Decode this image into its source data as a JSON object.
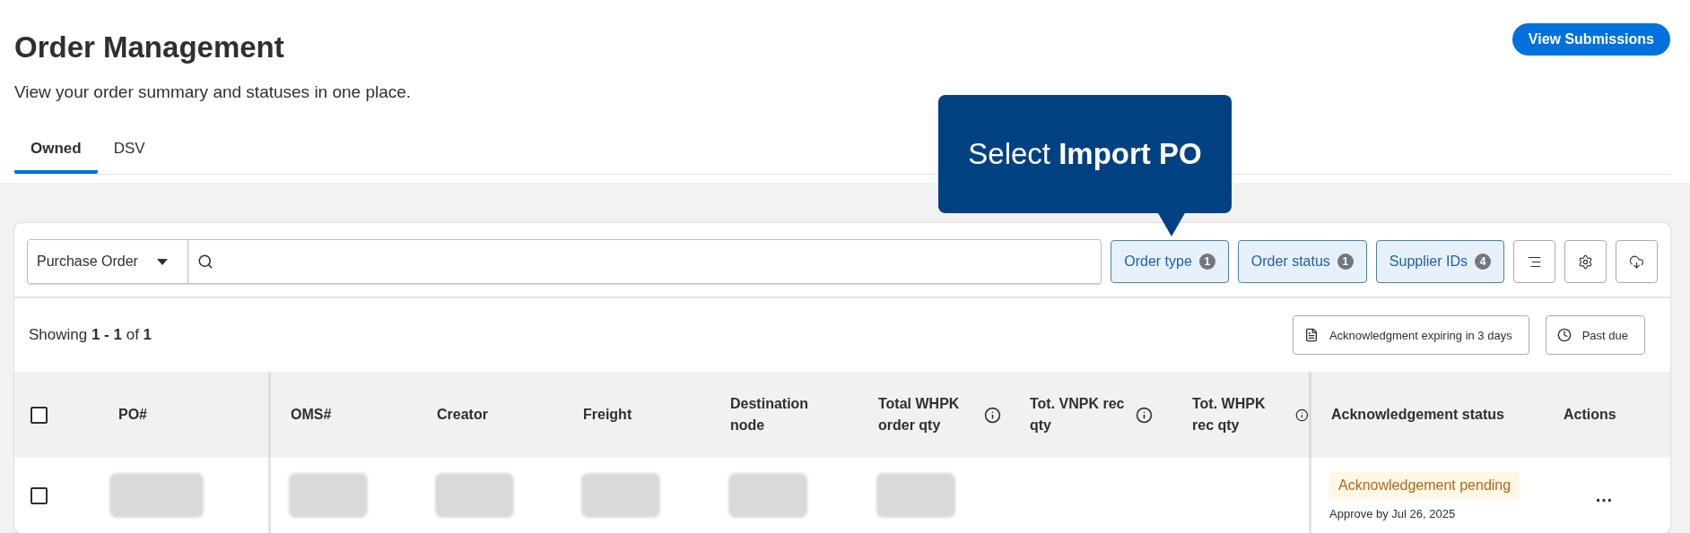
{
  "header": {
    "title": "Order Management",
    "subtitle": "View your order summary and statuses in one place.",
    "action_button": "View Submissions"
  },
  "tabs": [
    {
      "label": "Owned",
      "selected": true
    },
    {
      "label": "DSV",
      "selected": false
    }
  ],
  "tooltip": {
    "text": "Select **Import PO**"
  },
  "search": {
    "scope": "Purchase Order"
  },
  "filters": [
    {
      "label": "Order type",
      "count": "1"
    },
    {
      "label": "Order status",
      "count": "1"
    },
    {
      "label": "Supplier IDs",
      "count": "4"
    }
  ],
  "tool_buttons": [
    {
      "kind": "columns"
    },
    {
      "kind": "settings"
    },
    {
      "kind": "download"
    }
  ],
  "results": {
    "summary": "Showing **1 - 1** of **1**"
  },
  "quick_filters": [
    {
      "kind": "document",
      "label": "Acknowledgment expiring in 3 days"
    },
    {
      "kind": "clock",
      "label": "Past due"
    }
  ],
  "table": {
    "header_checked": false,
    "columns": [
      {
        "label": "PO#",
        "info": false
      },
      {
        "label": "OMS#",
        "info": false
      },
      {
        "label": "Creator",
        "info": false
      },
      {
        "label": "Freight",
        "info": false
      },
      {
        "label": "Destination node",
        "info": false
      },
      {
        "label": "Total WHPK order qty",
        "info": true
      },
      {
        "label": "Tot. VNPK rec qty",
        "info": true
      },
      {
        "label": "Tot. WHPK rec qty",
        "info": true
      },
      {
        "label": "Acknowledgement status",
        "info": false
      },
      {
        "label": "Actions",
        "info": false
      }
    ],
    "rows": [
      {
        "checked": false,
        "cells": [
          {
            "kind": "redacted"
          },
          {
            "kind": "redacted"
          },
          {
            "kind": "redacted"
          },
          {
            "kind": "redacted"
          },
          {
            "kind": "redacted"
          },
          {
            "kind": "redacted"
          },
          {
            "kind": "empty"
          },
          {
            "kind": "empty"
          },
          {
            "kind": "status",
            "badge": "Acknowledgement pending",
            "note": "Approve by Jul 26, 2025"
          },
          {
            "kind": "actions",
            "icon": "…"
          }
        ]
      }
    ]
  }
}
